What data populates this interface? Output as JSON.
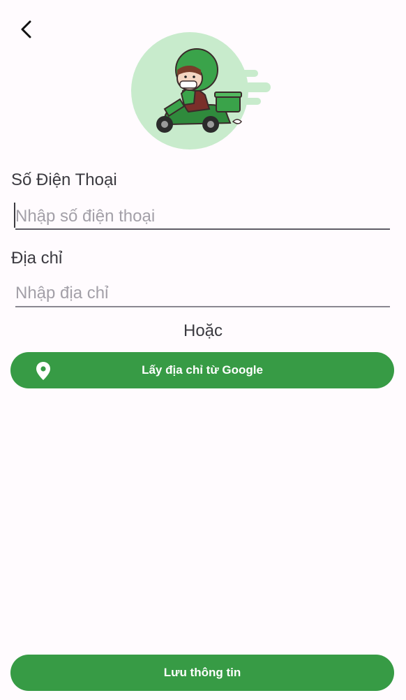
{
  "header": {
    "back_icon": "chevron-left-icon"
  },
  "illustration": {
    "icon": "delivery-scooter-icon",
    "bg_color": "#c8ebcc"
  },
  "phone": {
    "label": "Số Điện Thoại",
    "placeholder": "Nhập số điện thoại",
    "value": ""
  },
  "address": {
    "label": "Địa chỉ",
    "placeholder": "Nhập địa chỉ",
    "value": ""
  },
  "or_text": "Hoặc",
  "google_button": {
    "label": "Lấy địa chỉ từ Google",
    "icon": "location-pin-icon"
  },
  "save_button": {
    "label": "Lưu thông tin"
  },
  "colors": {
    "accent": "#379b45",
    "background": "#fffbfe",
    "text": "#3b3a40",
    "placeholder": "#a3a0a8"
  }
}
